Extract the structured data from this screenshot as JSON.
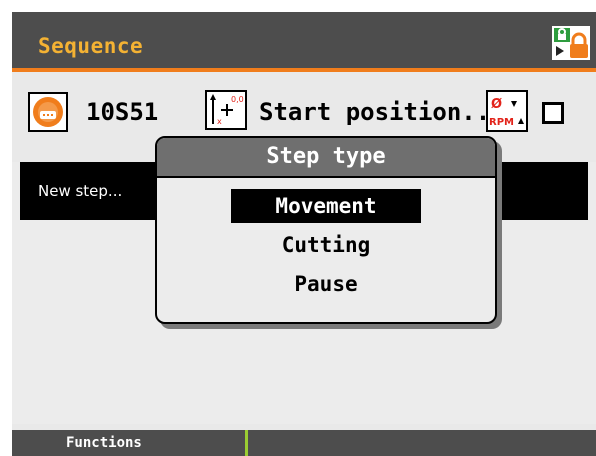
{
  "header": {
    "title": "Sequence",
    "corner_icon": "program-lock-icon"
  },
  "toolrow": {
    "tool_icon": "saw-blade-icon",
    "tool_id": "10S51",
    "position_icon": "position-axis-icon",
    "position_label": "Start position...",
    "rpm_icon": "rpm-adjust-icon",
    "rpm_icon_text": [
      "Ø",
      "RPM"
    ],
    "checkbox_checked": false
  },
  "list": {
    "items": [
      {
        "label": "New step..."
      }
    ]
  },
  "popup": {
    "title": "Step type",
    "options": [
      {
        "label": "Movement",
        "selected": true
      },
      {
        "label": "Cutting",
        "selected": false
      },
      {
        "label": "Pause",
        "selected": false
      }
    ]
  },
  "bottombar": {
    "functions_label": "Functions"
  },
  "colors": {
    "title_text": "#f4b233",
    "accent_line": "#f07d1c",
    "bar_bg": "#4d4d4d",
    "icon_red": "#e2231a",
    "tool_orange": "#f07d1c",
    "divider_green": "#9acd32"
  }
}
